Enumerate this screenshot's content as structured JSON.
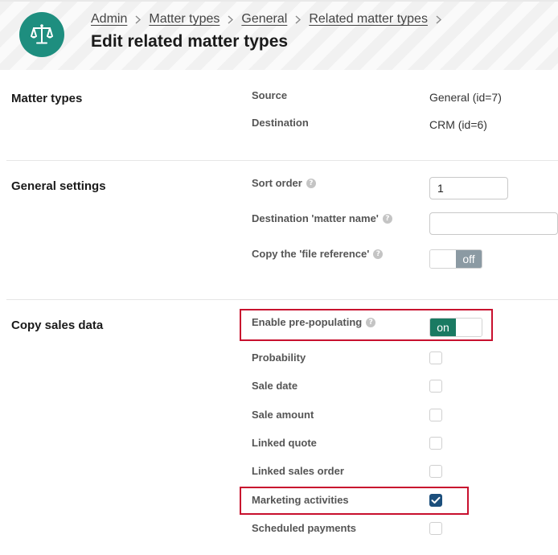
{
  "breadcrumb": [
    {
      "label": "Admin"
    },
    {
      "label": "Matter types"
    },
    {
      "label": "General"
    },
    {
      "label": "Related matter types"
    }
  ],
  "page_title": "Edit related matter types",
  "sections": {
    "matter_types": {
      "title": "Matter types",
      "source_label": "Source",
      "source_value": "General (id=7)",
      "destination_label": "Destination",
      "destination_value": "CRM (id=6)"
    },
    "general_settings": {
      "title": "General settings",
      "sort_order_label": "Sort order",
      "sort_order_value": "1",
      "destination_matter_name_label": "Destination 'matter name'",
      "destination_matter_name_value": "",
      "copy_file_reference_label": "Copy the 'file reference'",
      "copy_file_reference_state": "off"
    },
    "copy_sales_data": {
      "title": "Copy sales data",
      "enable_prepopulating_label": "Enable pre-populating",
      "enable_prepopulating_state": "on",
      "options": [
        {
          "label": "Probability",
          "checked": false
        },
        {
          "label": "Sale date",
          "checked": false
        },
        {
          "label": "Sale amount",
          "checked": false
        },
        {
          "label": "Linked quote",
          "checked": false
        },
        {
          "label": "Linked sales order",
          "checked": false
        },
        {
          "label": "Marketing activities",
          "checked": true
        },
        {
          "label": "Scheduled payments",
          "checked": false
        }
      ]
    }
  },
  "help_glyph": "?",
  "colors": {
    "logo_bg": "#1e8e7f",
    "toggle_on": "#1a7a62",
    "toggle_off": "#8b9aa3",
    "checkbox_checked": "#1c4f7c",
    "highlight": "#c8102e"
  },
  "icons": {
    "logo": "scales-icon",
    "breadcrumb_separator": "chevron-right-icon",
    "help": "help-icon",
    "check": "check-icon"
  }
}
